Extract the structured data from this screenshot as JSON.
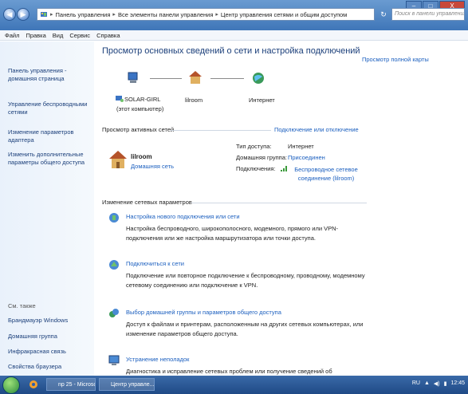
{
  "titlebar": {
    "breadcrumb": [
      "Панель управления",
      "Все элементы панели управления",
      "Центр управления сетями и общим доступом"
    ],
    "search_placeholder": "Поиск в панели управления",
    "window_buttons": [
      "–",
      "□",
      "X"
    ]
  },
  "menu": [
    "Файл",
    "Правка",
    "Вид",
    "Сервис",
    "Справка"
  ],
  "sidebar": {
    "links": [
      "Панель управления - домашняя страница",
      "Управление беспроводными сетями",
      "Изменение параметров адаптера",
      "Изменить дополнительные параметры общего доступа"
    ],
    "see_also_heading": "См. также",
    "see_also": [
      "Брандмауэр Windows",
      "Домашняя группа",
      "Инфракрасная связь",
      "Свойства браузера"
    ]
  },
  "main": {
    "title": "Просмотр основных сведений о сети и настройка подключений",
    "full_map_link": "Просмотр полной карты",
    "map": {
      "computer_name": "SOLAR-GIRL",
      "computer_sub": "(этот компьютер)",
      "router_name": "lilroom",
      "internet_name": "Интернет"
    },
    "active_label": "Просмотр активных сетей",
    "connect_link": "Подключение или отключение",
    "network": {
      "name": "lilroom",
      "type": "Домашняя сеть",
      "access_key": "Тип доступа:",
      "access_val": "Интернет",
      "homegroup_key": "Домашняя группа:",
      "homegroup_val": "Присоединен",
      "connections_key": "Подключения:",
      "connections_val": "Беспроводное сетевое соединение (lilroom)"
    },
    "change_label": "Изменение сетевых параметров",
    "tasks": [
      {
        "title": "Настройка нового подключения или сети",
        "desc": "Настройка беспроводного, широкополосного, модемного, прямого или VPN-подключения или же настройка маршрутизатора или точки доступа."
      },
      {
        "title": "Подключиться к сети",
        "desc": "Подключение или повторное подключение к беспроводному, проводному, модемному сетевому соединению или подключение к VPN."
      },
      {
        "title": "Выбор домашней группы и параметров общего доступа",
        "desc": "Доступ к файлам и принтерам, расположенным на других сетевых компьютерах, или изменение параметров общего доступа."
      },
      {
        "title": "Устранение неполадок",
        "desc": "Диагностика и исправление сетевых проблем или получение сведений об исправлении."
      }
    ]
  },
  "taskbar": {
    "items": [
      "np 25 - Microso...",
      "Центр управле..."
    ],
    "lang": "RU",
    "clock": "12:45"
  }
}
